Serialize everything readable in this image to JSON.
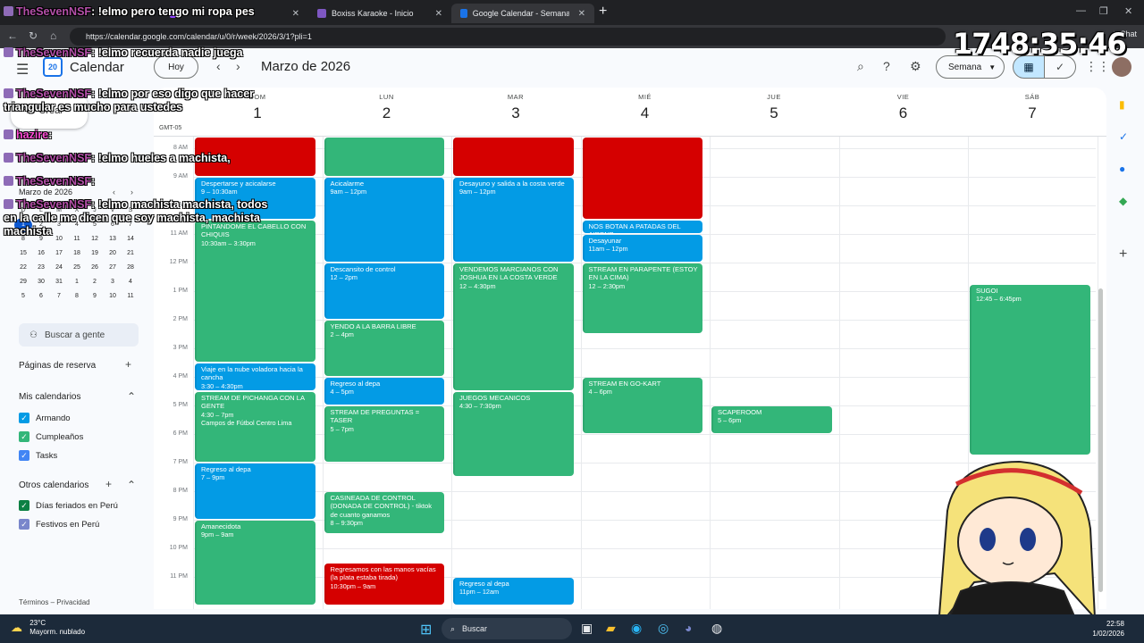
{
  "browser": {
    "tabs": [
      {
        "label": "TheSevenNSF: !elmo pero tengo mi ropa",
        "active": false
      },
      {
        "label": "Boxiss Karaoke - Inicio",
        "active": false
      },
      {
        "label": "Google Calendar - Semana del 1 d",
        "active": true
      }
    ],
    "url": "https://calendar.google.com/calendar/u/0/r/week/2026/3/1?pli=1",
    "chat_label": "Chat"
  },
  "header": {
    "app_title": "Calendar",
    "logo_day": "20",
    "today_label": "Hoy",
    "month_label": "Marzo de 2026",
    "view_label": "Semana"
  },
  "sidebar": {
    "create_label": "Crear",
    "mini_title": "Marzo de 2026",
    "mini_headers": [
      "D",
      "L",
      "M",
      "X",
      "J",
      "V",
      "S"
    ],
    "mini_weeks": [
      [
        "1",
        "2",
        "3",
        "4",
        "5",
        "6",
        "7"
      ],
      [
        "8",
        "9",
        "10",
        "11",
        "12",
        "13",
        "14"
      ],
      [
        "15",
        "16",
        "17",
        "18",
        "19",
        "20",
        "21"
      ],
      [
        "22",
        "23",
        "24",
        "25",
        "26",
        "27",
        "28"
      ],
      [
        "29",
        "30",
        "31",
        "1",
        "2",
        "3",
        "4"
      ],
      [
        "5",
        "6",
        "7",
        "8",
        "9",
        "10",
        "11"
      ]
    ],
    "search_people": "Buscar a gente",
    "booking_pages": "Páginas de reserva",
    "my_calendars_title": "Mis calendarios",
    "my_calendars": [
      {
        "label": "Armando",
        "color": "#039be5"
      },
      {
        "label": "Cumpleaños",
        "color": "#33b679"
      },
      {
        "label": "Tasks",
        "color": "#4285f4"
      }
    ],
    "other_calendars_title": "Otros calendarios",
    "other_calendars": [
      {
        "label": "Días feriados en Perú",
        "color": "#0b8043"
      },
      {
        "label": "Festivos en Perú",
        "color": "#7986cb"
      }
    ],
    "footer": "Términos – Privacidad"
  },
  "week": {
    "timezone": "GMT-05",
    "days": [
      {
        "dow": "DOM",
        "num": "1"
      },
      {
        "dow": "LUN",
        "num": "2"
      },
      {
        "dow": "MAR",
        "num": "3"
      },
      {
        "dow": "MIÉ",
        "num": "4"
      },
      {
        "dow": "JUE",
        "num": "5"
      },
      {
        "dow": "VIE",
        "num": "6"
      },
      {
        "dow": "SÁB",
        "num": "7"
      }
    ],
    "hours": [
      "8 AM",
      "9 AM",
      "10 AM",
      "11 AM",
      "12 PM",
      "1 PM",
      "2 PM",
      "3 PM",
      "4 PM",
      "5 PM",
      "6 PM",
      "7 PM",
      "8 PM",
      "9 PM",
      "10 PM",
      "11 PM"
    ],
    "events": [
      {
        "day": 0,
        "start": 7.6,
        "end": 9.0,
        "title": "",
        "time": "",
        "color": "red"
      },
      {
        "day": 0,
        "start": 9.0,
        "end": 10.5,
        "title": "Despertarse y acicalarse",
        "time": "9 – 10:30am",
        "color": "blue"
      },
      {
        "day": 0,
        "start": 10.5,
        "end": 15.5,
        "title": "PINTANDOME EL CABELLO CON CHIQUIS",
        "time": "10:30am – 3:30pm",
        "color": "green"
      },
      {
        "day": 0,
        "start": 15.5,
        "end": 16.5,
        "title": "Viaje en la nube voladora hacia la cancha",
        "time": "3:30 – 4:30pm",
        "color": "blue"
      },
      {
        "day": 0,
        "start": 16.5,
        "end": 19.0,
        "title": "STREAM DE PICHANGA CON LA GENTE",
        "time": "4:30 – 7pm",
        "extra": "Campos de Fútbol Centro Lima",
        "color": "green"
      },
      {
        "day": 0,
        "start": 19.0,
        "end": 21.0,
        "title": "Regreso al depa",
        "time": "7 – 9pm",
        "color": "blue"
      },
      {
        "day": 0,
        "start": 21.0,
        "end": 24.0,
        "title": "Amanecidota",
        "time": "9pm – 9am",
        "color": "green"
      },
      {
        "day": 1,
        "start": 7.6,
        "end": 9.0,
        "title": "",
        "time": "",
        "color": "green"
      },
      {
        "day": 1,
        "start": 9.0,
        "end": 12.0,
        "title": "Acicalarme",
        "time": "9am – 12pm",
        "color": "blue"
      },
      {
        "day": 1,
        "start": 12.0,
        "end": 14.0,
        "title": "Descansito de control",
        "time": "12 – 2pm",
        "color": "blue"
      },
      {
        "day": 1,
        "start": 14.0,
        "end": 16.0,
        "title": "YENDO A LA BARRA LIBRE",
        "time": "2 – 4pm",
        "color": "green"
      },
      {
        "day": 1,
        "start": 16.0,
        "end": 17.0,
        "title": "Regreso al depa",
        "time": "4 – 5pm",
        "color": "blue"
      },
      {
        "day": 1,
        "start": 17.0,
        "end": 19.0,
        "title": "STREAM DE PREGUNTAS = TASER",
        "time": "5 – 7pm",
        "color": "green"
      },
      {
        "day": 1,
        "start": 20.0,
        "end": 21.5,
        "title": "CASINEADA DE CONTROL (DONADA DE CONTROL) - tiktok de cuanto ganamos",
        "time": "8 – 9:30pm",
        "color": "green"
      },
      {
        "day": 1,
        "start": 22.5,
        "end": 24.0,
        "title": "Regresamos con las manos vacías (la plata estaba tirada)",
        "time": "10:30pm – 9am",
        "color": "red"
      },
      {
        "day": 2,
        "start": 7.6,
        "end": 9.0,
        "title": "",
        "time": "",
        "color": "red"
      },
      {
        "day": 2,
        "start": 9.0,
        "end": 12.0,
        "title": "Desayuno y salida a la costa verde",
        "time": "9am – 12pm",
        "color": "blue"
      },
      {
        "day": 2,
        "start": 12.0,
        "end": 16.5,
        "title": "VENDEMOS MARCIANOS CON JOSHUA EN LA COSTA VERDE",
        "time": "12 – 4:30pm",
        "color": "green"
      },
      {
        "day": 2,
        "start": 16.5,
        "end": 19.5,
        "title": "JUEGOS MECANICOS",
        "time": "4:30 – 7:30pm",
        "color": "green"
      },
      {
        "day": 2,
        "start": 23.0,
        "end": 24.0,
        "title": "Regreso al depa",
        "time": "11pm – 12am",
        "color": "blue"
      },
      {
        "day": 3,
        "start": 7.6,
        "end": 10.5,
        "title": "",
        "time": "",
        "color": "red"
      },
      {
        "day": 3,
        "start": 10.5,
        "end": 11.0,
        "title": "NOS BOTAN A PATADAS DEL AIRBNB",
        "time": "",
        "color": "blue"
      },
      {
        "day": 3,
        "start": 11.0,
        "end": 12.0,
        "title": "Desayunar",
        "time": "11am – 12pm",
        "color": "blue"
      },
      {
        "day": 3,
        "start": 12.0,
        "end": 14.5,
        "title": "STREAM EN PARAPENTE (ESTOY EN LA CIMA)",
        "time": "12 – 2:30pm",
        "color": "green"
      },
      {
        "day": 3,
        "start": 16.0,
        "end": 18.0,
        "title": "STREAM EN GO-KART",
        "time": "4 – 6pm",
        "color": "green"
      },
      {
        "day": 4,
        "start": 17.0,
        "end": 18.0,
        "title": "SCAPEROOM",
        "time": "5 – 6pm",
        "color": "green"
      },
      {
        "day": 6,
        "start": 12.75,
        "end": 18.75,
        "title": "SUGOI",
        "time": "12:45 – 6:45pm",
        "color": "green"
      }
    ]
  },
  "overlay": {
    "timer": "1748:35:46",
    "chat": [
      {
        "user": "TheSevenNSF",
        "msg": ": !elmo pero tengo mi ropa pes"
      },
      {
        "user": "TheSevenNSF",
        "msg": ": !elmo recuerda nadie juega"
      },
      {
        "user": "TheSevenNSF",
        "msg": ": !elmo por eso digo que hacer triangular es mucho para ustedes"
      },
      {
        "user": "hazire",
        "msg": ":"
      },
      {
        "user": "TheSevenNSF",
        "msg": ": !elmo hueles a machista,"
      },
      {
        "user": "TheSevenNSF",
        "msg": ":"
      },
      {
        "user": "TheSevenNSF",
        "msg": ": !elmo machista machista, todos en la calle me dicen que soy machista, machista machista"
      }
    ]
  },
  "taskbar": {
    "temp": "23°C",
    "weather": "Mayorm. nublado",
    "search": "Buscar",
    "time": "22:58",
    "date": "1/02/2026"
  }
}
